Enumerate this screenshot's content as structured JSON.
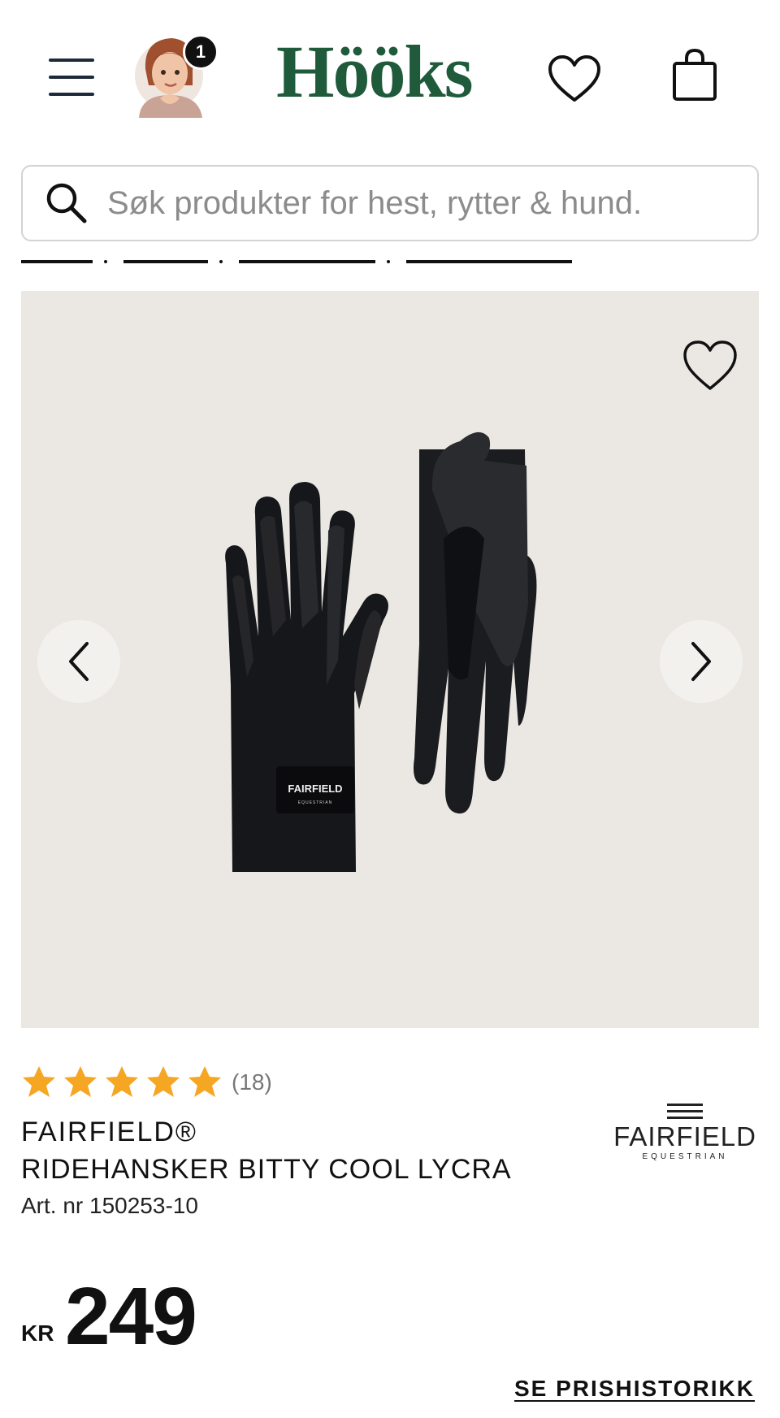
{
  "header": {
    "logo_text": "Hööks",
    "notification_count": "1",
    "menu_icon": "hamburger-menu-icon",
    "wishlist_icon": "heart-icon",
    "cart_icon": "shopping-bag-icon"
  },
  "search": {
    "placeholder": "Søk produkter for hest, rytter & hund.",
    "value": ""
  },
  "gallery": {
    "wishlist_icon": "heart-icon",
    "prev_icon": "chevron-left-icon",
    "next_icon": "chevron-right-icon",
    "image_label": "FAIRFIELD",
    "image_sublabel": "EQUESTRIAN"
  },
  "product": {
    "rating": 5,
    "rating_max": 5,
    "review_count": "(18)",
    "brand": "FAIRFIELD®",
    "name": "RIDEHANSKER BITTY COOL LYCRA",
    "article_number": "Art. nr 150253-10",
    "brand_logo_name": "FAIRFIELD",
    "brand_logo_sub": "EQUESTRIAN",
    "currency": "KR",
    "price": "249",
    "price_history_link": "SE PRISHISTORIKK"
  },
  "colors": {
    "logo_green": "#1f5a3a",
    "star_orange": "#f5a623",
    "gallery_bg": "#ebe8e4"
  }
}
